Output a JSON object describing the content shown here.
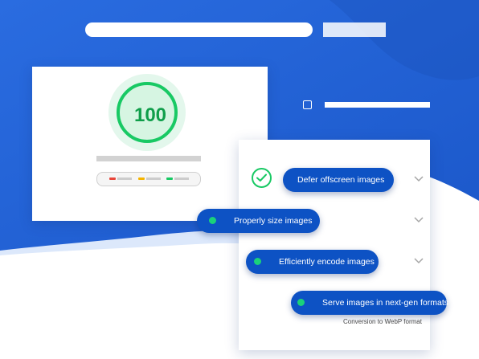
{
  "score_card": {
    "score": "100",
    "score_color": "#18c964"
  },
  "audits": {
    "items": [
      {
        "label": "Defer offscreen images",
        "status": "passed",
        "expandable": true
      },
      {
        "label": "Properly size images",
        "expandable": true
      },
      {
        "label": "Efficiently encode images",
        "expandable": true
      },
      {
        "label": "Serve images in next-gen formats",
        "expandable": false
      }
    ],
    "caption": "Conversion to WebP format"
  },
  "legend": {
    "colors": [
      "#e8463a",
      "#f5b400",
      "#18c964"
    ]
  },
  "colors": {
    "brand_blue": "#1e5fd4",
    "pill_blue": "#0d52c4",
    "pass_green": "#1ad17a"
  },
  "icons": [
    "checkmark-icon",
    "chevron-down-icon",
    "status-dot-icon"
  ]
}
